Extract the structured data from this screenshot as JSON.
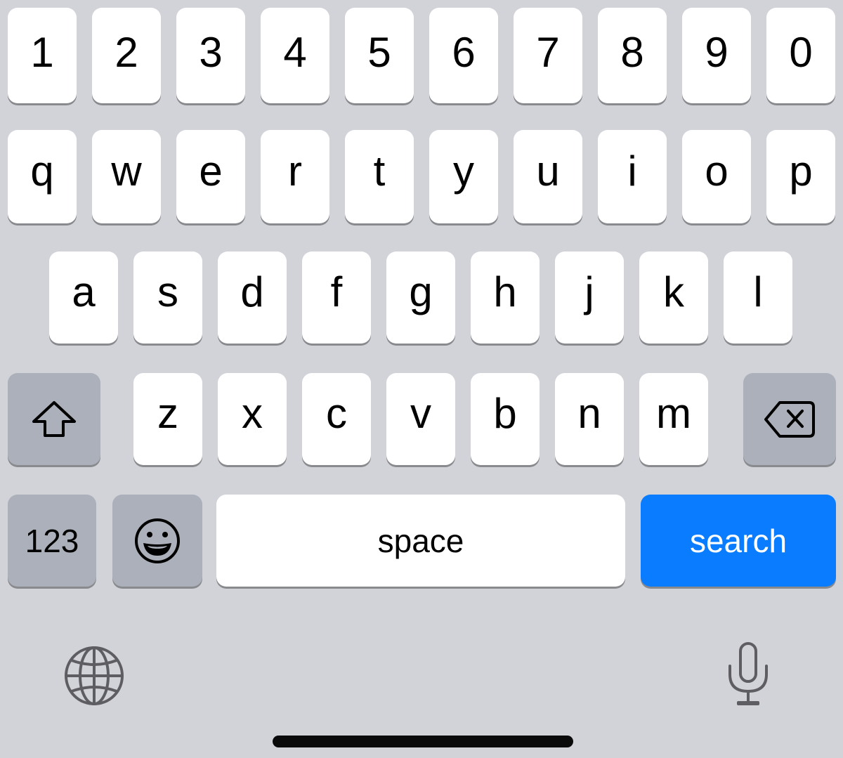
{
  "keyboard": {
    "rows": {
      "numbers": [
        "1",
        "2",
        "3",
        "4",
        "5",
        "6",
        "7",
        "8",
        "9",
        "0"
      ],
      "top": [
        "q",
        "w",
        "e",
        "r",
        "t",
        "y",
        "u",
        "i",
        "o",
        "p"
      ],
      "middle": [
        "a",
        "s",
        "d",
        "f",
        "g",
        "h",
        "j",
        "k",
        "l"
      ],
      "bottom": [
        "z",
        "x",
        "c",
        "v",
        "b",
        "n",
        "m"
      ]
    },
    "shift": {
      "icon": "shift-arrow-icon"
    },
    "delete": {
      "icon": "backspace-icon"
    },
    "numbers_toggle_label": "123",
    "emoji": {
      "icon": "emoji-smiley-icon"
    },
    "space_label": "space",
    "search_label": "search",
    "globe": {
      "icon": "globe-icon"
    },
    "dictation": {
      "icon": "microphone-icon"
    }
  },
  "colors": {
    "background": "#d1d3d9",
    "key": "#ffffff",
    "function_key": "#abb0ba",
    "accent": "#0a7cff",
    "key_shadow": "#898a8e",
    "icon_gray": "#5e5e62"
  }
}
